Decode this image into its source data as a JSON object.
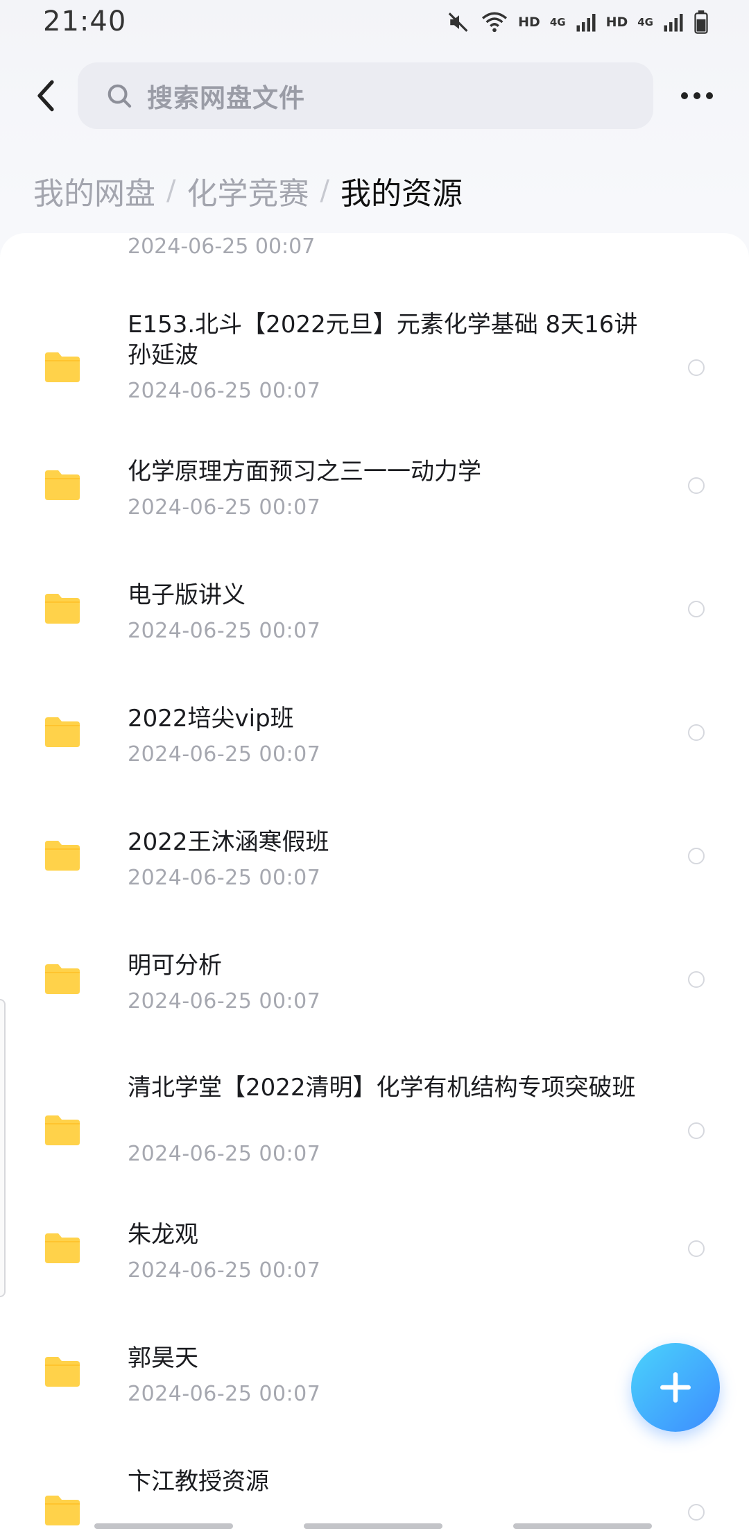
{
  "status_bar": {
    "time": "21:40",
    "hd_1": "HD",
    "net_1": "4G",
    "hd_2": "HD",
    "net_2": "4G",
    "icons": [
      "mute-icon",
      "wifi-icon",
      "signal-icon",
      "signal-icon",
      "battery-icon"
    ]
  },
  "header": {
    "search_placeholder": "搜索网盘文件",
    "back_icon": "chevron-left-icon",
    "more_icon": "more-dots-icon"
  },
  "breadcrumb": {
    "items": [
      "我的网盘",
      "化学竞赛",
      "我的资源"
    ],
    "separator": "/"
  },
  "files": {
    "first_partial_date": "2024-06-25  00:07",
    "folder_color": "#FFD24A",
    "items": [
      {
        "name": "E153.北斗【2022元旦】元素化学基础 8天16讲 孙延波",
        "date": "2024-06-25  00:07"
      },
      {
        "name": "化学原理方面预习之三一一动力学",
        "date": "2024-06-25  00:07"
      },
      {
        "name": "电子版讲义",
        "date": "2024-06-25  00:07"
      },
      {
        "name": "2022培尖vip班",
        "date": "2024-06-25  00:07"
      },
      {
        "name": "2022王沐涵寒假班",
        "date": "2024-06-25  00:07"
      },
      {
        "name": "明可分析",
        "date": "2024-06-25  00:07"
      },
      {
        "name": "清北学堂【2022清明】化学有机结构专项突破班",
        "date": "2024-06-25  00:07"
      },
      {
        "name": "朱龙观",
        "date": "2024-06-25  00:07"
      },
      {
        "name": "郭昊天",
        "date": "2024-06-25  00:07"
      },
      {
        "name": "卞江教授资源",
        "date": ""
      }
    ]
  },
  "fab": {
    "icon": "plus-icon",
    "color_start": "#4AD3FB",
    "color_end": "#3D8CFF"
  }
}
